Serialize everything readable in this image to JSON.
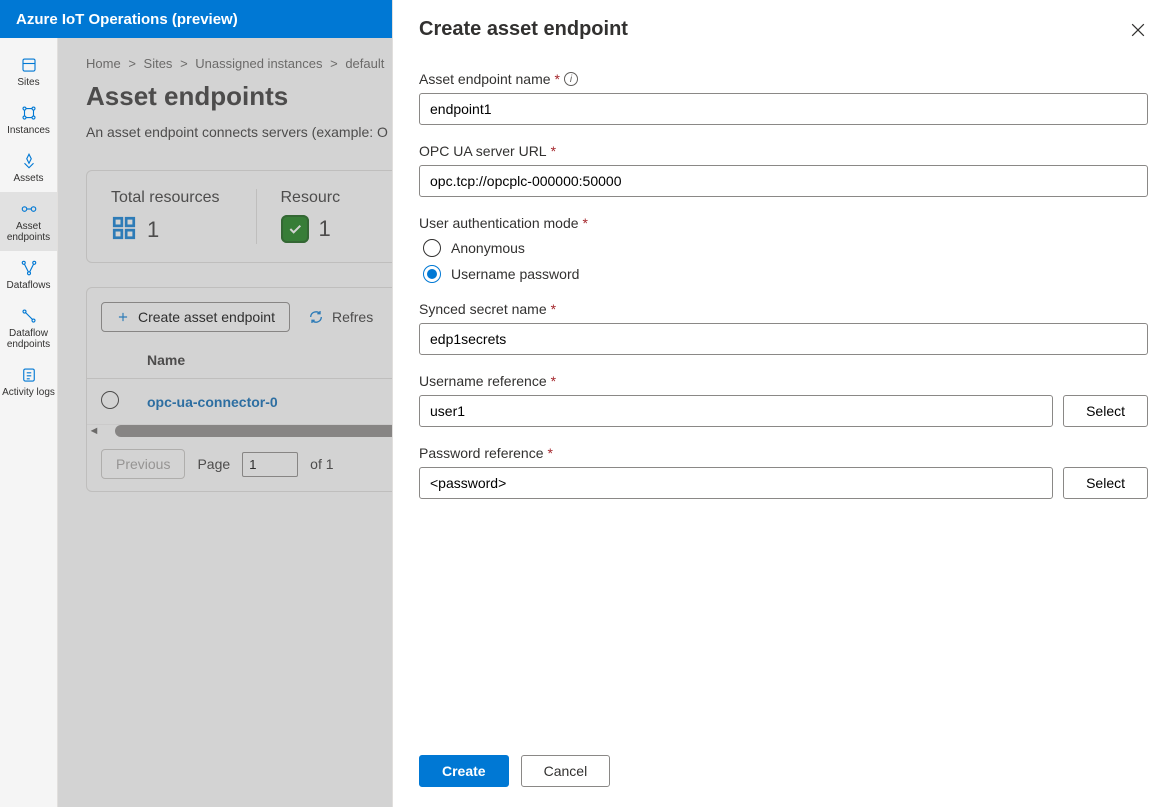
{
  "topbar": {
    "title": "Azure IoT Operations (preview)"
  },
  "leftnav": {
    "items": [
      {
        "label": "Sites"
      },
      {
        "label": "Instances"
      },
      {
        "label": "Assets"
      },
      {
        "label": "Asset endpoints"
      },
      {
        "label": "Dataflows"
      },
      {
        "label": "Dataflow endpoints"
      },
      {
        "label": "Activity logs"
      }
    ]
  },
  "breadcrumb": {
    "items": [
      "Home",
      "Sites",
      "Unassigned instances",
      "default"
    ],
    "chevron": ">"
  },
  "page": {
    "title": "Asset endpoints",
    "subtitle_prefix": "An asset endpoint connects servers (example: O"
  },
  "cards": {
    "total": {
      "label": "Total resources",
      "value": "1"
    },
    "resource": {
      "label_visible": "Resourc",
      "value": "1"
    }
  },
  "toolbar": {
    "create_label": "Create asset endpoint",
    "refresh_label": "Refres"
  },
  "table": {
    "columns": [
      "Name"
    ],
    "rows": [
      {
        "name": "opc-ua-connector-0"
      }
    ]
  },
  "pager": {
    "previous": "Previous",
    "page_label": "Page",
    "page_value": "1",
    "of_total": "of 1"
  },
  "panel": {
    "title": "Create asset endpoint",
    "fields": {
      "endpoint_name": {
        "label": "Asset endpoint name",
        "value": "endpoint1"
      },
      "server_url": {
        "label": "OPC UA server URL",
        "value": "opc.tcp://opcplc-000000:50000"
      },
      "auth_mode": {
        "label": "User authentication mode",
        "options": {
          "anonymous": "Anonymous",
          "usernamepw": "Username password"
        },
        "selected": "usernamepw"
      },
      "secret_name": {
        "label": "Synced secret name",
        "value": "edp1secrets"
      },
      "username_ref": {
        "label": "Username reference",
        "value": "user1",
        "select_label": "Select"
      },
      "password_ref": {
        "label": "Password reference",
        "value": "<password>",
        "select_label": "Select"
      }
    },
    "footer": {
      "create": "Create",
      "cancel": "Cancel"
    }
  }
}
